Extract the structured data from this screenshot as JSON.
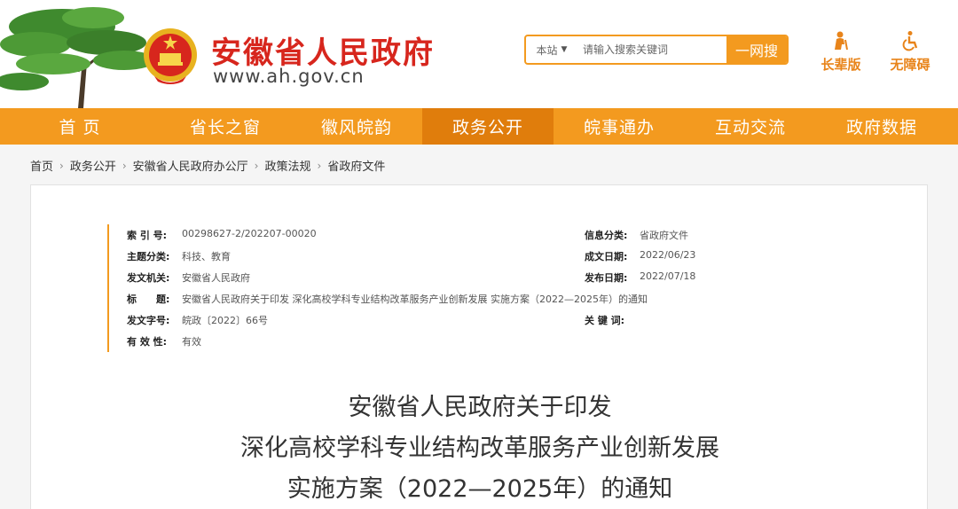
{
  "header": {
    "site_title": "安徽省人民政府",
    "site_url": "www.ah.gov.cn",
    "search": {
      "scope": "本站",
      "placeholder": "请输入搜索关键词",
      "button": "一网搜"
    },
    "tools": {
      "elder": "长辈版",
      "accessible": "无障碍"
    }
  },
  "nav": [
    "首 页",
    "省长之窗",
    "徽风皖韵",
    "政务公开",
    "皖事通办",
    "互动交流",
    "政府数据"
  ],
  "nav_active_index": 3,
  "breadcrumb": [
    "首页",
    "政务公开",
    "安徽省人民政府办公厅",
    "政策法规",
    "省政府文件"
  ],
  "meta": {
    "index_label": "索 引 号:",
    "index_value": "00298627-2/202207-00020",
    "category_label": "信息分类:",
    "category_value": "省政府文件",
    "topic_label": "主题分类:",
    "topic_value": "科技、教育",
    "created_label": "成文日期:",
    "created_value": "2022/06/23",
    "issuer_label": "发文机关:",
    "issuer_value": "安徽省人民政府",
    "published_label": "发布日期:",
    "published_value": "2022/07/18",
    "title_label": "标　　题:",
    "title_value": "安徽省人民政府关于印发 深化高校学科专业结构改革服务产业创新发展 实施方案（2022—2025年）的通知",
    "docno_label": "发文字号:",
    "docno_value": "皖政〔2022〕66号",
    "keywords_label": "关 键 词:",
    "keywords_value": "",
    "validity_label": "有 效 性:",
    "validity_value": "有效"
  },
  "doc_title": {
    "line1": "安徽省人民政府关于印发",
    "line2": "深化高校学科专业结构改革服务产业创新发展",
    "line3": "实施方案（2022—2025年）的通知"
  },
  "colors": {
    "brand_orange": "#f39a1f",
    "nav_active": "#e07d0c",
    "title_red": "#d7261d"
  }
}
